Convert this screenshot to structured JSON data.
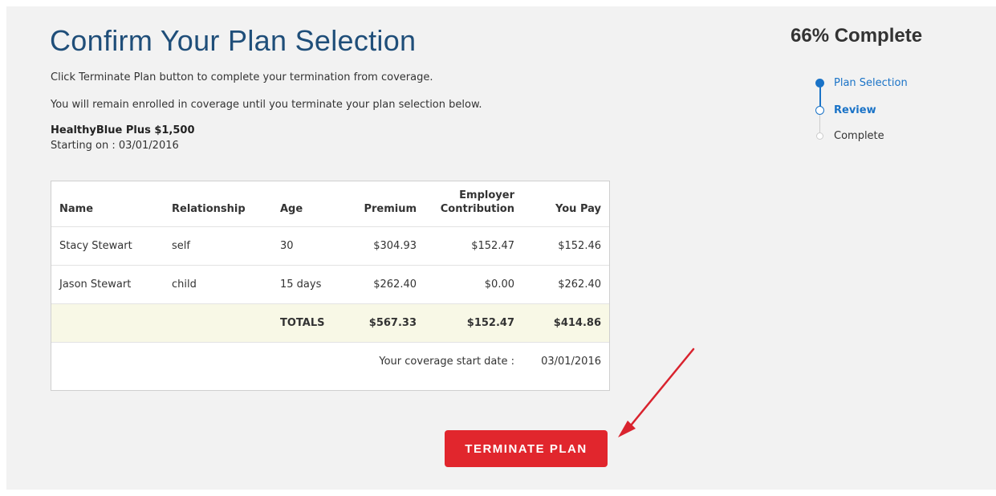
{
  "page": {
    "title": "Confirm Your Plan Selection",
    "intro_line_1": "Click Terminate Plan button to complete your termination from coverage.",
    "intro_line_2": "You will remain enrolled in coverage until you terminate your plan selection below."
  },
  "plan": {
    "name": "HealthyBlue Plus $1,500",
    "start_label": "Starting on : 03/01/2016"
  },
  "table": {
    "headers": {
      "name": "Name",
      "relationship": "Relationship",
      "age": "Age",
      "premium": "Premium",
      "employer_line1": "Employer",
      "employer_line2": "Contribution",
      "you_pay": "You Pay"
    },
    "rows": [
      {
        "name": "Stacy Stewart",
        "relationship": "self",
        "age": "30",
        "premium": "$304.93",
        "employer": "$152.47",
        "you_pay": "$152.46"
      },
      {
        "name": "Jason Stewart",
        "relationship": "child",
        "age": "15 days",
        "premium": "$262.40",
        "employer": "$0.00",
        "you_pay": "$262.40"
      }
    ],
    "totals": {
      "label": "TOTALS",
      "premium": "$567.33",
      "employer": "$152.47",
      "you_pay": "$414.86"
    },
    "coverage_start": {
      "label": "Your coverage start date :",
      "value": "03/01/2016"
    }
  },
  "actions": {
    "terminate_label": "TERMINATE PLAN"
  },
  "progress": {
    "title": "66% Complete",
    "percent": 66,
    "steps": [
      {
        "label": "Plan Selection",
        "state": "done"
      },
      {
        "label": "Review",
        "state": "current"
      },
      {
        "label": "Complete",
        "state": "pending"
      }
    ]
  },
  "colors": {
    "title_blue": "#1f4e79",
    "step_blue": "#1a73c7",
    "terminate_red": "#e1262d",
    "annotation_red": "#d9232e",
    "panel_bg": "#f2f2f2",
    "totals_bg": "#f8f8e6"
  },
  "icons": {
    "annotation": "red-arrow-icon",
    "step_done": "filled-circle-icon",
    "step_current": "hollow-circle-icon",
    "step_pending": "empty-circle-icon"
  }
}
